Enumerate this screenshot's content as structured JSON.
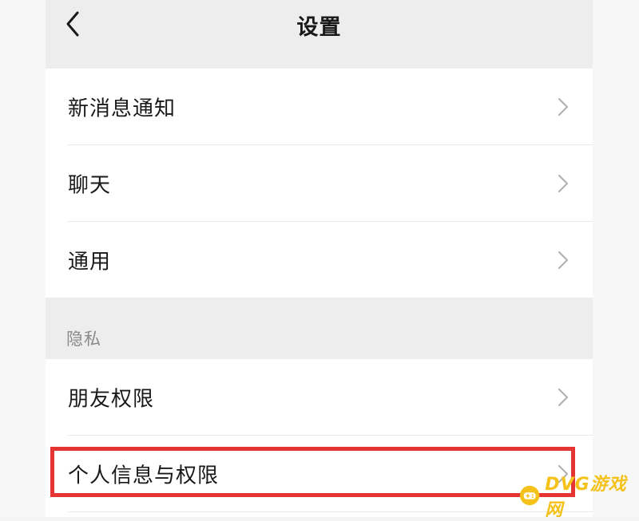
{
  "navbar": {
    "title": "设置",
    "back_icon": "chevron-left-icon"
  },
  "general_group": {
    "items": [
      {
        "label": "新消息通知"
      },
      {
        "label": "聊天"
      },
      {
        "label": "通用"
      }
    ]
  },
  "privacy_section": {
    "header": "隐私",
    "items": [
      {
        "label": "朋友权限"
      },
      {
        "label": "个人信息与权限"
      }
    ]
  },
  "highlight": {
    "target": "个人信息与权限",
    "color": "#e63432"
  },
  "watermark": {
    "text": "DVG游戏网",
    "color": "#f4c21a"
  },
  "colors": {
    "background": "#ededed",
    "card": "#ffffff",
    "text": "#191919",
    "secondary_text": "#8a8a8a",
    "chevron": "#b2b2b2"
  }
}
